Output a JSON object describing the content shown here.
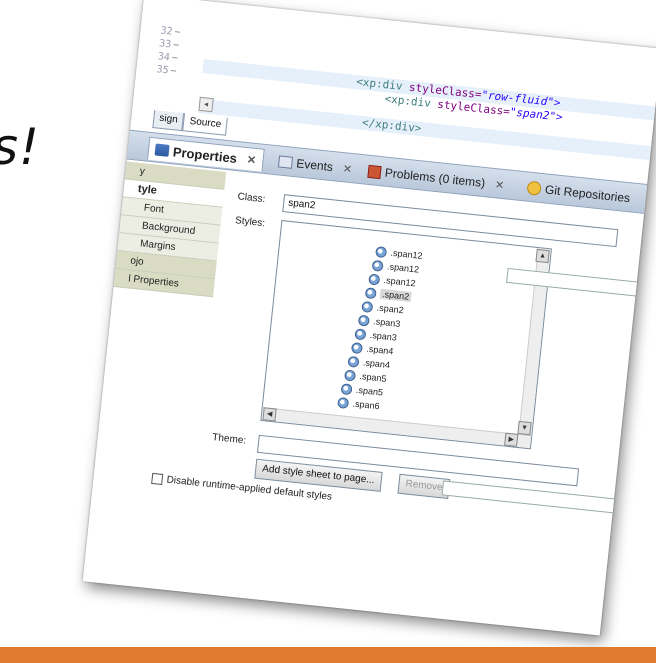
{
  "slide": {
    "text": "s!"
  },
  "editor": {
    "line_numbers": [
      "32",
      "33",
      "34",
      "35"
    ],
    "code": {
      "line1": {
        "tag_open": "<xp:div ",
        "attr": "styleClass=",
        "value": "\"row-fluid\">"
      },
      "line2": {
        "tag_open": "<xp:div ",
        "attr": "styleClass=",
        "value": "\"span2\">"
      },
      "line3": {
        "tag_close": "</xp:div>"
      }
    },
    "design_tab": "sign",
    "source_tab": "Source"
  },
  "panel_tabs": [
    {
      "label": "Properties",
      "icon": "properties-icon",
      "active": true
    },
    {
      "label": "Events",
      "icon": "events-icon"
    },
    {
      "label": "Problems (0 items)",
      "icon": "problems-icon"
    },
    {
      "label": "Git Repositories",
      "icon": "git-icon"
    }
  ],
  "left_nav": [
    "y",
    "tyle",
    "Font",
    "Background",
    "Margins",
    "ojo",
    "l Properties"
  ],
  "form": {
    "class_label": "Class:",
    "class_value": "span2",
    "styles_label": "Styles:",
    "theme_label": "Theme:",
    "styles_list": [
      ".span12",
      ".span12",
      ".span12",
      ".span2",
      ".span2",
      ".span3",
      ".span3",
      ".span4",
      ".span4",
      ".span5",
      ".span5",
      ".span6"
    ],
    "selected_style": ".span2",
    "add_button": "Add style sheet to page...",
    "remove_button": "Remove",
    "disable_checkbox": "Disable runtime-applied default styles"
  },
  "icons": {
    "style_item": "css-class-icon",
    "scroll_up": "arrow-up-icon",
    "scroll_down": "arrow-down-icon",
    "scroll_left": "arrow-left-icon",
    "scroll_right": "arrow-right-icon"
  },
  "colors": {
    "accent_bar": "#e07a2c",
    "panel_header": "#c5d3e4",
    "nav_group": "#d9dcc3"
  }
}
